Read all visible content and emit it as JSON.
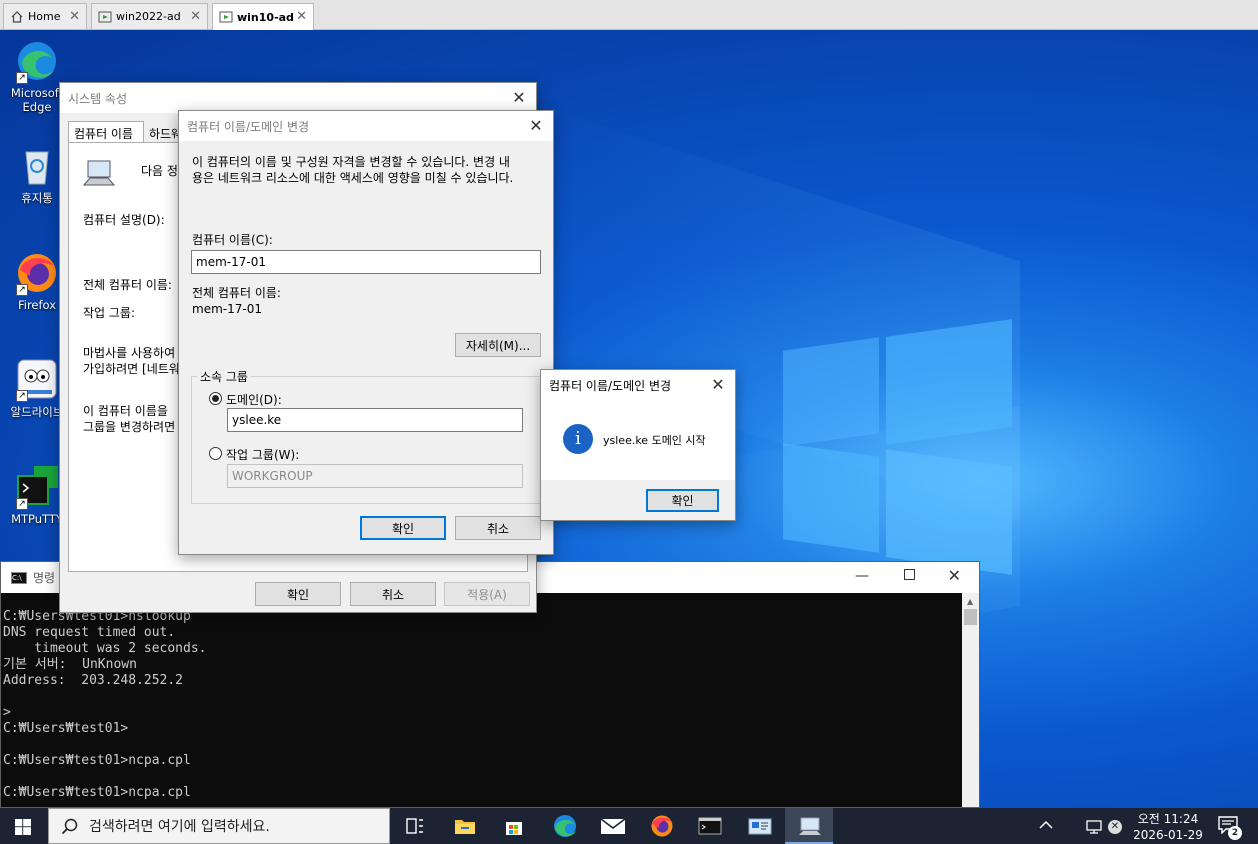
{
  "tabs": [
    {
      "label": "Home"
    },
    {
      "label": "win2022-ad"
    },
    {
      "label": "win10-ad"
    }
  ],
  "desktop_icons": [
    {
      "label": "Microsoft Edge"
    },
    {
      "label": "휴지통"
    },
    {
      "label": "Firefox"
    },
    {
      "label": "알드라이브"
    },
    {
      "label": "MTPuTTY"
    }
  ],
  "sysprops": {
    "title": "시스템 속성",
    "tabs": [
      "컴퓨터 이름",
      "하드웨어"
    ],
    "intro": "다음 정",
    "desc_label": "컴퓨터 설명(D):",
    "fullname_label": "전체 컴퓨터 이름:",
    "workgroup_label": "작업 그룹:",
    "wizard_line1": "마법사를 사용하여",
    "wizard_line2": "가입하려면 [네트워",
    "rename_line1": "이 컴퓨터 이름을",
    "rename_line2": "그룹을 변경하려면",
    "ok": "확인",
    "cancel": "취소",
    "apply": "적용(A)"
  },
  "rename": {
    "title": "컴퓨터 이름/도메인 변경",
    "desc_line1": "이 컴퓨터의 이름 및 구성원 자격을 변경할 수 있습니다. 변경 내",
    "desc_line2": "용은 네트워크 리소스에 대한 액세스에 영향을 미칠 수 있습니다.",
    "name_label": "컴퓨터 이름(C):",
    "name_value": "mem-17-01",
    "full_label": "전체 컴퓨터 이름:",
    "full_value": "mem-17-01",
    "more": "자세히(M)...",
    "group_title": "소속 그룹",
    "domain_label": "도메인(D):",
    "domain_value": "yslee.ke",
    "workgroup_label": "작업 그룹(W):",
    "workgroup_value": "WORKGROUP",
    "ok": "확인",
    "cancel": "취소"
  },
  "msgbox": {
    "title": "컴퓨터 이름/도메인 변경",
    "message": "yslee.ke 도메인 시작",
    "ok": "확인"
  },
  "cmd": {
    "title": "명령",
    "lines": [
      "C:₩Users₩test01>nslookup",
      "DNS request timed out.",
      "    timeout was 2 seconds.",
      "기본 서버:  UnKnown",
      "Address:  203.248.252.2",
      "",
      ">",
      "C:₩Users₩test01>",
      "",
      "C:₩Users₩test01>ncpa.cpl",
      "",
      "C:₩Users₩test01>ncpa.cpl"
    ]
  },
  "taskbar": {
    "search_placeholder": "검색하려면 여기에 입력하세요.",
    "time": "오전 11:24",
    "date": "2026-01-29",
    "notification_count": "2"
  },
  "colors": {
    "accent": "#0078d7",
    "taskbar": "#1c2433",
    "info_icon": "#1a62c4"
  }
}
